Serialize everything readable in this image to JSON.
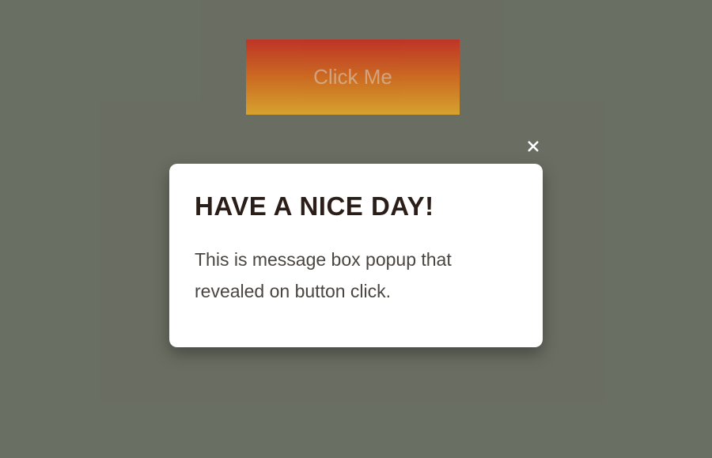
{
  "button": {
    "label": "Click Me"
  },
  "modal": {
    "title": "HAVE A NICE DAY!",
    "text": "This is message box popup that revealed on button click."
  }
}
